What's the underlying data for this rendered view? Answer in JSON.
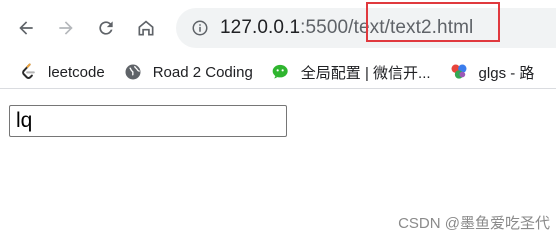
{
  "toolbar": {
    "icons": [
      "back-arrow-icon",
      "forward-arrow-icon",
      "reload-icon",
      "home-icon"
    ],
    "url": {
      "host": "127.0.0.1",
      "path": ":5500/text/text2.html"
    },
    "highlight_color": "#e0393e"
  },
  "bookmarks": {
    "items": [
      {
        "label": "leetcode",
        "icon": "leetcode-icon"
      },
      {
        "label": "Road 2 Coding",
        "icon": "globe-icon"
      },
      {
        "label": "全局配置 | 微信开...",
        "icon": "wechat-icon"
      },
      {
        "label": "glgs - 路",
        "icon": "glgs-icon"
      }
    ]
  },
  "page": {
    "input_value": "lq"
  },
  "watermark": "CSDN @墨鱼爱吃圣代"
}
